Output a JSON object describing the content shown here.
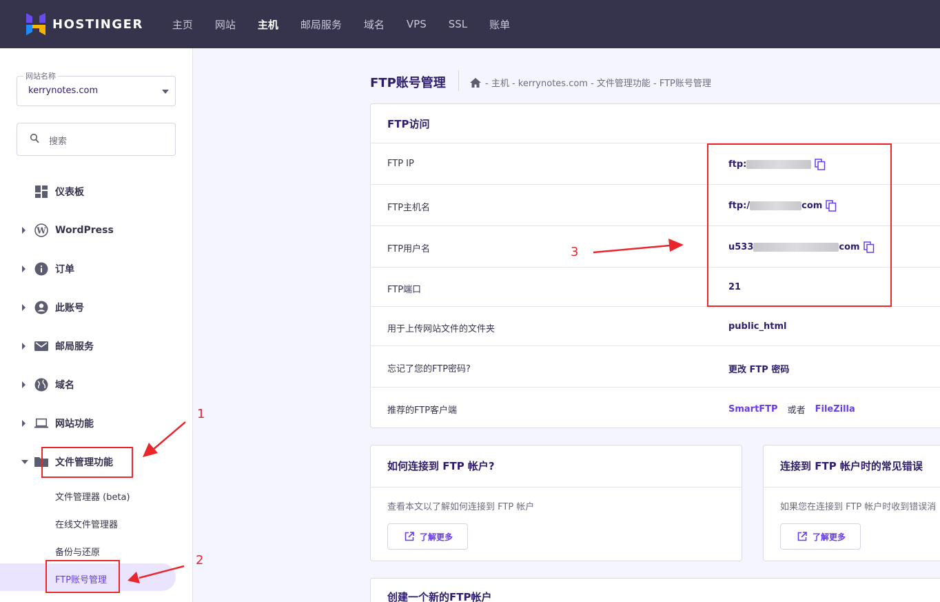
{
  "brand": {
    "name": "HOSTINGER"
  },
  "topnav": {
    "items": [
      "主页",
      "网站",
      "主机",
      "邮局服务",
      "域名",
      "VPS",
      "SSL",
      "账单"
    ],
    "active_index": 2
  },
  "sidebar": {
    "site_select": {
      "legend": "网站名称",
      "value": "kerrynotes.com"
    },
    "search": {
      "placeholder": "搜索"
    },
    "items": [
      {
        "label": "仪表板",
        "icon": "dashboard-icon"
      },
      {
        "label": "WordPress",
        "icon": "wordpress-icon"
      },
      {
        "label": "订单",
        "icon": "info-icon"
      },
      {
        "label": "此账号",
        "icon": "account-icon"
      },
      {
        "label": "邮局服务",
        "icon": "mail-icon"
      },
      {
        "label": "域名",
        "icon": "globe-icon"
      },
      {
        "label": "网站功能",
        "icon": "laptop-icon"
      },
      {
        "label": "文件管理功能",
        "icon": "folder-icon"
      }
    ],
    "sub_items": [
      "文件管理器 (beta)",
      "在线文件管理器",
      "备份与还原",
      "FTP账号管理"
    ]
  },
  "main": {
    "title": "FTP账号管理",
    "breadcrumb": "- 主机 - kerrynotes.com - 文件管理功能 - FTP账号管理",
    "ftp_card": {
      "title": "FTP访问",
      "rows": [
        {
          "key": "FTP IP",
          "value_prefix": "ftp:",
          "value_suffix": ""
        },
        {
          "key": "FTP主机名",
          "value_prefix": "ftp:/",
          "value_suffix": "com"
        },
        {
          "key": "FTP用户名",
          "value_prefix": "u533",
          "value_suffix": "com"
        },
        {
          "key": "FTP端口",
          "value": "21"
        },
        {
          "key": "用于上传网站文件的文件夹",
          "value": "public_html"
        },
        {
          "key": "忘记了您的FTP密码?",
          "link": "更改 FTP 密码"
        },
        {
          "key": "推荐的FTP客户端",
          "link1": "SmartFTP",
          "or": "或者",
          "link2": "FileZilla"
        }
      ]
    },
    "info_cards": [
      {
        "title": "如何连接到 FTP 帐户?",
        "text": "查看本文以了解如何连接到 FTP 帐户",
        "button": "了解更多"
      },
      {
        "title": "连接到 FTP 帐户时的常见错误",
        "text": "如果您在连接到 FTP 帐户时收到错误消",
        "button": "了解更多"
      },
      {
        "title": "创建一个新的FTP帐户"
      }
    ]
  },
  "annotations": {
    "n1": "1",
    "n2": "2",
    "n3": "3"
  },
  "colors": {
    "accent": "#673de6",
    "topbar": "#36344d",
    "annotation": "#e8262c"
  }
}
